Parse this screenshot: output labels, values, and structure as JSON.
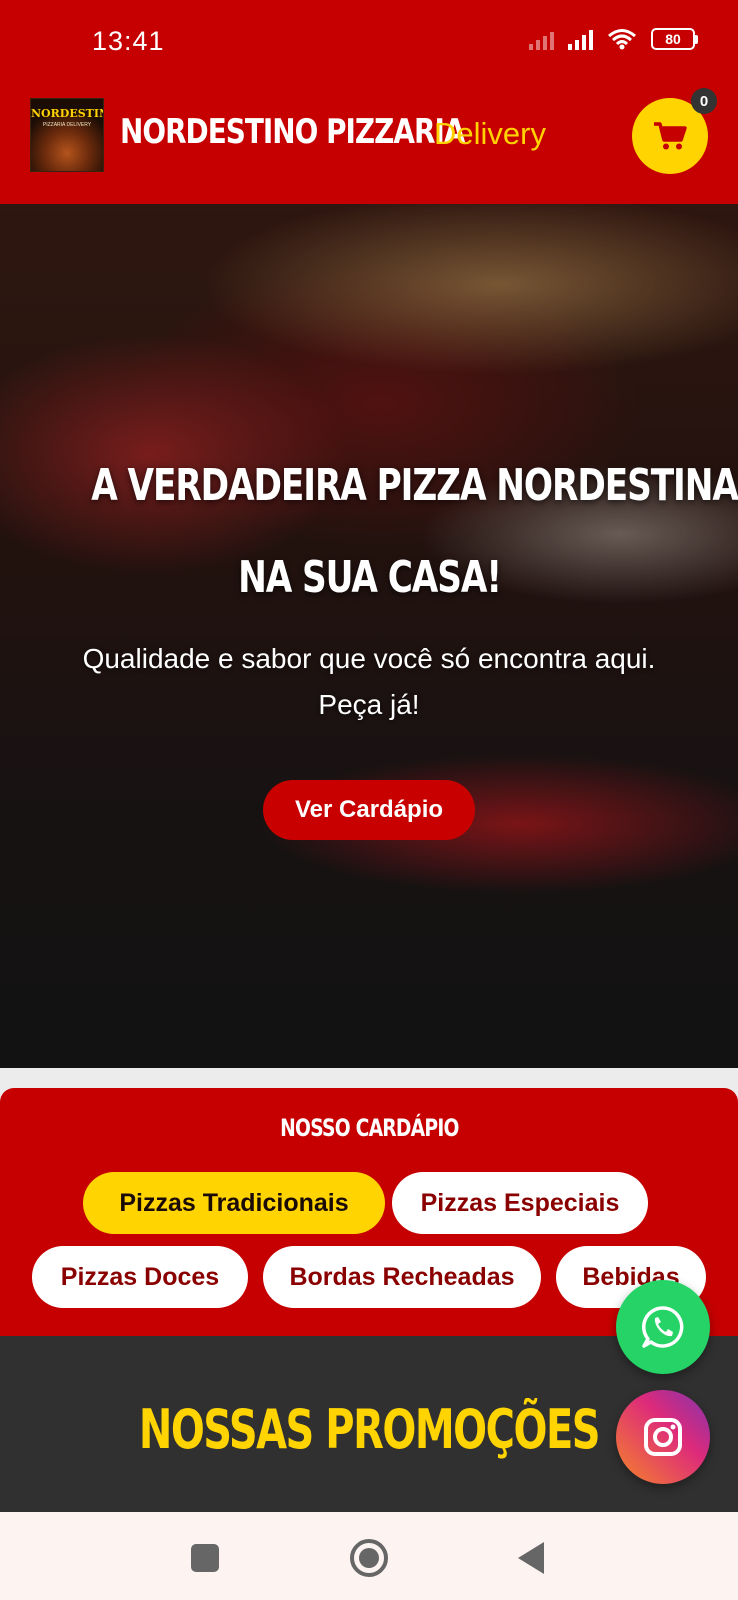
{
  "status_bar": {
    "time": "13:41",
    "battery": "80"
  },
  "header": {
    "logo_text": "NORDESTINO",
    "logo_subtext": "PIZZARIA DELIVERY",
    "brand": "NORDESTINO PIZZARIA",
    "tagline": "Delivery",
    "cart_count": "0",
    "accent_color": "#c60000",
    "highlight_color": "#ffd400"
  },
  "hero": {
    "title_line1": "A VERDADEIRA PIZZA NORDESTINA",
    "title_line2": "NA SUA CASA!",
    "subtitle_line1": "Qualidade e sabor que você só encontra aqui.",
    "subtitle_line2": "Peça já!",
    "cta_label": "Ver Cardápio"
  },
  "menu": {
    "title": "NOSSO CARDÁPIO",
    "categories": [
      {
        "label": "Pizzas Tradicionais",
        "active": true
      },
      {
        "label": "Pizzas Especiais",
        "active": false
      },
      {
        "label": "Pizzas Doces",
        "active": false
      },
      {
        "label": "Bordas Recheadas",
        "active": false
      },
      {
        "label": "Bebidas",
        "active": false
      }
    ]
  },
  "promotions": {
    "title": "NOSSAS PROMOÇÕES"
  },
  "floating": {
    "whatsapp_icon": "whatsapp-icon",
    "instagram_icon": "instagram-icon"
  },
  "nav": {
    "recent_icon": "square-icon",
    "home_icon": "circle-icon",
    "back_icon": "triangle-back-icon"
  }
}
